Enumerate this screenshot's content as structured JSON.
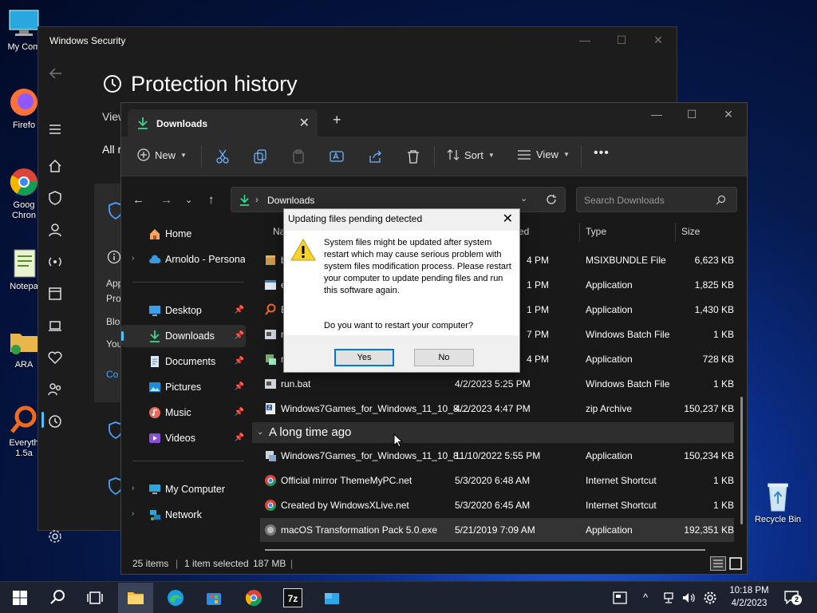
{
  "desktop": {
    "icons": [
      {
        "label": "My Com"
      },
      {
        "label": "Firefo"
      },
      {
        "label": "Goog\nChron"
      },
      {
        "label": "Notepa"
      },
      {
        "label": "ARA"
      },
      {
        "label": "Everyth\n1.5a"
      },
      {
        "label": "Recycle Bin"
      }
    ]
  },
  "security": {
    "title": "Windows Security",
    "heading": "Protection history",
    "fragments": [
      "View",
      "All r",
      "App",
      "Pro",
      "Blo",
      "You",
      "Co"
    ]
  },
  "explorer": {
    "tab_label": "Downloads",
    "toolbar": {
      "new": "New",
      "sort": "Sort",
      "view": "View",
      "more": "•••"
    },
    "address": "Downloads",
    "search_placeholder": "Search Downloads",
    "nav": {
      "home": "Home",
      "cloud": "Arnoldo - Personal",
      "desktop": "Desktop",
      "downloads": "Downloads",
      "documents": "Documents",
      "pictures": "Pictures",
      "music": "Music",
      "videos": "Videos",
      "computer": "My Computer",
      "network": "Network"
    },
    "columns": {
      "name": "Na",
      "date": "ed",
      "type": "Type",
      "size": "Size"
    },
    "rows_recent": [
      {
        "name": "b",
        "date": "4 PM",
        "type": "MSIXBUNDLE File",
        "size": "6,623 KB"
      },
      {
        "name": "e",
        "date": "1 PM",
        "type": "Application",
        "size": "1,825 KB"
      },
      {
        "name": "E",
        "date": "1 PM",
        "type": "Application",
        "size": "1,430 KB"
      },
      {
        "name": "r",
        "date": "7 PM",
        "type": "Windows Batch File",
        "size": "1 KB"
      },
      {
        "name": "n",
        "date": "4 PM",
        "type": "Application",
        "size": "728 KB"
      },
      {
        "name": "run.bat",
        "date": "4/2/2023 5:25 PM",
        "type": "Windows Batch File",
        "size": "1 KB"
      },
      {
        "name": "Windows7Games_for_Windows_11_10_8....",
        "date": "4/2/2023 4:47 PM",
        "type": "zip Archive",
        "size": "150,237 KB"
      }
    ],
    "group_label": "A long time ago",
    "rows_old": [
      {
        "name": "Windows7Games_for_Windows_11_10_8....",
        "date": "11/10/2022 5:55 PM",
        "type": "Application",
        "size": "150,234 KB"
      },
      {
        "name": "Official mirror ThemeMyPC.net",
        "date": "5/3/2020 6:48 AM",
        "type": "Internet Shortcut",
        "size": "1 KB"
      },
      {
        "name": "Created by WindowsXLive.net",
        "date": "5/3/2020 6:45 AM",
        "type": "Internet Shortcut",
        "size": "1 KB"
      },
      {
        "name": "macOS Transformation Pack 5.0.exe",
        "date": "5/21/2019 7:09 AM",
        "type": "Application",
        "size": "192,351 KB"
      }
    ],
    "status": {
      "items": "25 items",
      "selected": "1 item selected",
      "size": "187 MB"
    }
  },
  "dialog": {
    "title": "Updating files pending detected",
    "message": "System files might be updated after system restart which may cause serious problem with system files modification process. Please restart your computer to update pending files and run this software again.",
    "question": "Do you want to restart your computer?",
    "yes": "Yes",
    "no": "No"
  },
  "taskbar": {
    "time": "10:18 PM",
    "date": "4/2/2023",
    "notification_count": "2",
    "sevenzip_label": "7z"
  },
  "colors": {
    "accent": "#4cc2ff",
    "taskbar_bg": "#1c2230"
  }
}
